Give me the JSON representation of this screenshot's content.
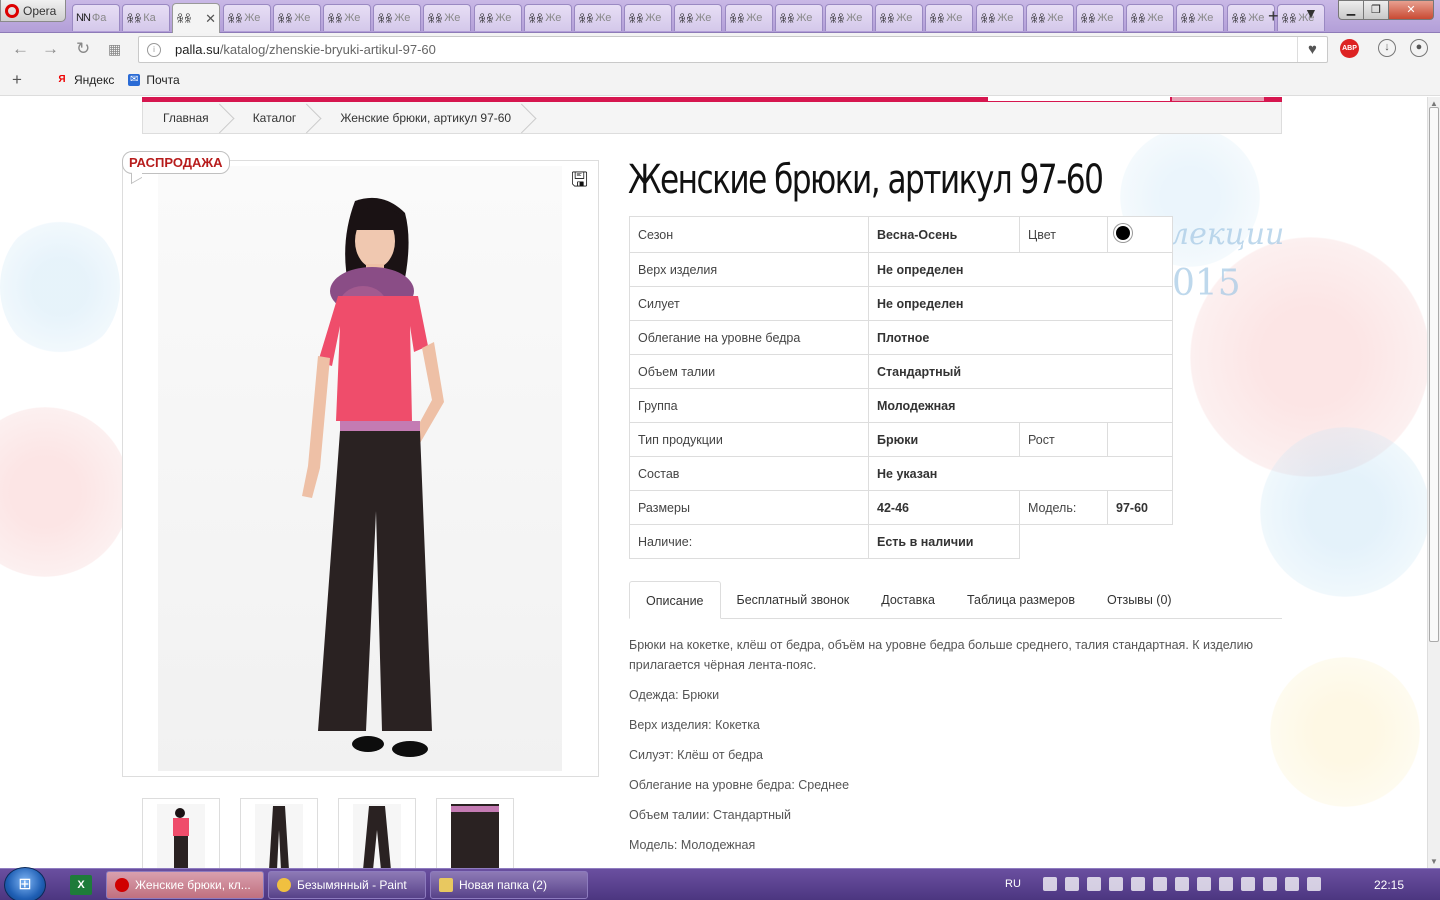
{
  "browser": {
    "opera_label": "Opera",
    "tabs": [
      {
        "icon": "NN",
        "title": "Фа"
      },
      {
        "icon": "ꆜꆜ",
        "title": "Ка"
      },
      {
        "icon": "ꆜꆜ",
        "title": "",
        "active": true
      },
      {
        "icon": "ꆜꆜ",
        "title": "Же"
      },
      {
        "icon": "ꆜꆜ",
        "title": "Же"
      },
      {
        "icon": "ꆜꆜ",
        "title": "Же"
      },
      {
        "icon": "ꆜꆜ",
        "title": "Же"
      },
      {
        "icon": "ꆜꆜ",
        "title": "Же"
      },
      {
        "icon": "ꆜꆜ",
        "title": "Же"
      },
      {
        "icon": "ꆜꆜ",
        "title": "Же"
      },
      {
        "icon": "ꆜꆜ",
        "title": "Же"
      },
      {
        "icon": "ꆜꆜ",
        "title": "Же"
      },
      {
        "icon": "ꆜꆜ",
        "title": "Же"
      },
      {
        "icon": "ꆜꆜ",
        "title": "Же"
      },
      {
        "icon": "ꆜꆜ",
        "title": "Же"
      },
      {
        "icon": "ꆜꆜ",
        "title": "Же"
      },
      {
        "icon": "ꆜꆜ",
        "title": "Же"
      },
      {
        "icon": "ꆜꆜ",
        "title": "Же"
      },
      {
        "icon": "ꆜꆜ",
        "title": "Же"
      },
      {
        "icon": "ꆜꆜ",
        "title": "Же"
      },
      {
        "icon": "ꆜꆜ",
        "title": "Же"
      },
      {
        "icon": "ꆜꆜ",
        "title": "Же"
      },
      {
        "icon": "ꆜꆜ",
        "title": "Же"
      },
      {
        "icon": "ꆜꆜ",
        "title": "Же"
      },
      {
        "icon": "ꆜꆜ",
        "title": "Же"
      }
    ],
    "url_host": "palla.su",
    "url_path": "/katalog/zhenskie-bryuki-artikul-97-60",
    "abp_label": "ABP",
    "bookmarks": [
      {
        "label": "Яндекс",
        "icon": "Я"
      },
      {
        "label": "Почта",
        "icon": "✉"
      }
    ]
  },
  "page": {
    "breadcrumb": [
      "Главная",
      "Каталог",
      "Женские брюки, артикул 97-60"
    ],
    "sale_badge": "РАСПРОДАЖА",
    "title": "Женские брюки, артикул 97-60",
    "properties": [
      {
        "key": "Сезон",
        "value": "Весна-Осень",
        "key2": "Цвет",
        "value2_color": "#000000"
      },
      {
        "key": "Верх изделия",
        "value": "Не определен"
      },
      {
        "key": "Силует",
        "value": "Не определен"
      },
      {
        "key": "Облегание на уровне бедра",
        "value": "Плотное"
      },
      {
        "key": "Объем талии",
        "value": "Стандартный"
      },
      {
        "key": "Группа",
        "value": "Молодежная"
      },
      {
        "key": "Тип продукции",
        "value": "Брюки",
        "key2": "Рост",
        "value2": ""
      },
      {
        "key": "Состав",
        "value": "Не указан"
      },
      {
        "key": "Размеры",
        "value": "42-46",
        "key2": "Модель:",
        "value2": "97-60"
      },
      {
        "key": "Наличие:",
        "value": "Есть в наличии"
      }
    ],
    "tabs": [
      "Описание",
      "Бесплатный звонок",
      "Доставка",
      "Таблица размеров",
      "Отзывы (0)"
    ],
    "description": [
      "Брюки на кокетке, клёш от бедра, объём на уровне бедра больше среднего, талия стандартная. К изделию прилагается чёрная лента-пояс.",
      "Одежда: Брюки",
      "Верх изделия: Кокетка",
      "Силуэт: Клёш от бедра",
      "Облегание на уровне бедра: Среднее",
      "Объем талии: Стандартный",
      "Модель: Молодежная"
    ],
    "bg_text_1": "лекции",
    "bg_text_2": "015"
  },
  "taskbar": {
    "buttons": [
      {
        "label": "Женские брюки, кл...",
        "active": true,
        "color": "#d00000"
      },
      {
        "label": "Безымянный - Paint",
        "active": false,
        "color": "#f0c040"
      },
      {
        "label": "Новая папка (2)",
        "active": false,
        "color": "#e8c860"
      }
    ],
    "lang": "RU",
    "clock": "22:15"
  }
}
